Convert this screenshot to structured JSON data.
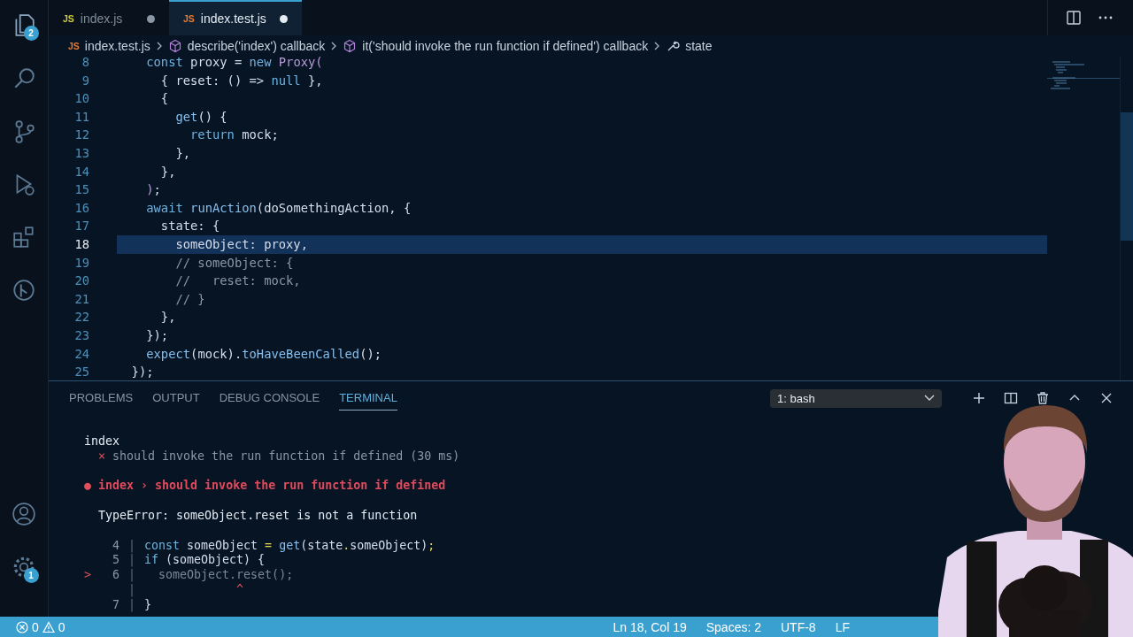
{
  "activity_bar": {
    "items": [
      {
        "kind": "files",
        "selected": true,
        "badge": "2"
      },
      {
        "kind": "search",
        "selected": false
      },
      {
        "kind": "source-control",
        "selected": false
      },
      {
        "kind": "debug",
        "selected": false
      },
      {
        "kind": "extensions",
        "selected": false
      },
      {
        "kind": "remote",
        "selected": false
      }
    ],
    "bottom": [
      {
        "kind": "account"
      },
      {
        "kind": "settings",
        "badge": "1"
      }
    ]
  },
  "tabs": [
    {
      "icon_text": "JS",
      "color": "#cbcb41",
      "label": "index.js",
      "selected": false,
      "dirty": true
    },
    {
      "icon_text": "JS",
      "color": "#e37933",
      "label": "index.test.js",
      "selected": true,
      "dirty": true
    }
  ],
  "breadcrumbs": [
    {
      "kind": "file",
      "icon_text": "JS",
      "color": "#e37933",
      "label": "index.test.js"
    },
    {
      "kind": "symbol",
      "label": "describe('index') callback"
    },
    {
      "kind": "symbol",
      "label": "it('should invoke the run function if defined') callback"
    },
    {
      "kind": "property",
      "label": "state"
    }
  ],
  "editor": {
    "lines": [
      {
        "number": "8",
        "highlighted": false,
        "tokens": [
          {
            "kind": "keyword",
            "text": "    const "
          },
          {
            "kind": "plain",
            "text": "proxy = "
          },
          {
            "kind": "keyword",
            "text": "new "
          },
          {
            "kind": "type",
            "text": "Proxy("
          }
        ]
      },
      {
        "number": "9",
        "highlighted": false,
        "tokens": [
          {
            "kind": "plain",
            "text": "      { reset: () => "
          },
          {
            "kind": "keyword",
            "text": "null"
          },
          {
            "kind": "plain",
            "text": " },"
          }
        ]
      },
      {
        "number": "10",
        "highlighted": false,
        "tokens": [
          {
            "kind": "plain",
            "text": "      {"
          }
        ]
      },
      {
        "number": "11",
        "highlighted": false,
        "tokens": [
          {
            "kind": "function",
            "text": "        get"
          },
          {
            "kind": "plain",
            "text": "() {"
          }
        ]
      },
      {
        "number": "12",
        "highlighted": false,
        "tokens": [
          {
            "kind": "keyword",
            "text": "          return "
          },
          {
            "kind": "plain",
            "text": "mock;"
          }
        ]
      },
      {
        "number": "13",
        "highlighted": false,
        "tokens": [
          {
            "kind": "plain",
            "text": "        },"
          }
        ]
      },
      {
        "number": "14",
        "highlighted": false,
        "tokens": [
          {
            "kind": "plain",
            "text": "      },"
          }
        ]
      },
      {
        "number": "15",
        "highlighted": false,
        "tokens": [
          {
            "kind": "type",
            "text": "    )"
          },
          {
            "kind": "plain",
            "text": ";"
          }
        ]
      },
      {
        "number": "16",
        "highlighted": false,
        "tokens": [
          {
            "kind": "keyword",
            "text": "    await "
          },
          {
            "kind": "function",
            "text": "runAction"
          },
          {
            "kind": "plain",
            "text": "(doSomethingAction, {"
          }
        ]
      },
      {
        "number": "17",
        "highlighted": false,
        "tokens": [
          {
            "kind": "plain",
            "text": "      state: {"
          }
        ]
      },
      {
        "number": "18",
        "highlighted": true,
        "tokens": [
          {
            "kind": "plain",
            "text": "        someObject: proxy,"
          }
        ]
      },
      {
        "number": "19",
        "highlighted": false,
        "tokens": [
          {
            "kind": "comment",
            "text": "        // someObject: {"
          }
        ]
      },
      {
        "number": "20",
        "highlighted": false,
        "tokens": [
          {
            "kind": "comment",
            "text": "        //   reset: mock,"
          }
        ]
      },
      {
        "number": "21",
        "highlighted": false,
        "tokens": [
          {
            "kind": "comment",
            "text": "        // }"
          }
        ]
      },
      {
        "number": "22",
        "highlighted": false,
        "tokens": [
          {
            "kind": "plain",
            "text": "      },"
          }
        ]
      },
      {
        "number": "23",
        "highlighted": false,
        "tokens": [
          {
            "kind": "plain",
            "text": "    });"
          }
        ]
      },
      {
        "number": "24",
        "highlighted": false,
        "tokens": [
          {
            "kind": "function",
            "text": "    expect"
          },
          {
            "kind": "plain",
            "text": "(mock)."
          },
          {
            "kind": "function",
            "text": "toHaveBeenCalled"
          },
          {
            "kind": "plain",
            "text": "();"
          }
        ]
      },
      {
        "number": "25",
        "highlighted": false,
        "tokens": [
          {
            "kind": "plain",
            "text": "  });"
          }
        ]
      }
    ]
  },
  "panel": {
    "tabs": [
      {
        "label": "PROBLEMS",
        "selected": false
      },
      {
        "label": "OUTPUT",
        "selected": false
      },
      {
        "label": "DEBUG CONSOLE",
        "selected": false
      },
      {
        "label": "TERMINAL",
        "selected": true
      }
    ],
    "terminal_select": {
      "value": "1: bash"
    },
    "terminal": {
      "suite": "index",
      "failed_test": {
        "mark": "×",
        "name": "should invoke the run function if defined (30 ms)"
      },
      "failure": {
        "bullet": "●",
        "title": "index › should invoke the run function if defined"
      },
      "error": "TypeError: someObject.reset is not a function",
      "frame": [
        {
          "kind": "line",
          "gutter": "|",
          "number": "4",
          "dim": false,
          "tokens": [
            {
              "kind": "keyword",
              "text": "const "
            },
            {
              "kind": "plain",
              "text": "someObject "
            },
            {
              "kind": "operator",
              "text": "= "
            },
            {
              "kind": "function",
              "text": "get"
            },
            {
              "kind": "plain",
              "text": "(state"
            },
            {
              "kind": "operator",
              "text": "."
            },
            {
              "kind": "plain",
              "text": "someObject)"
            },
            {
              "kind": "operator",
              "text": ";"
            }
          ]
        },
        {
          "kind": "line",
          "gutter": "|",
          "number": "5",
          "dim": false,
          "tokens": [
            {
              "kind": "keyword",
              "text": "if "
            },
            {
              "kind": "plain",
              "text": "(someObject) {"
            }
          ]
        },
        {
          "kind": "line",
          "marker": ">",
          "gutter": "|",
          "number": "6",
          "dim": true,
          "tokens": [
            {
              "kind": "plain",
              "text": "  someObject"
            },
            {
              "kind": "operator",
              "text": "."
            },
            {
              "kind": "plain",
              "text": "reset()"
            },
            {
              "kind": "operator",
              "text": ";"
            }
          ]
        },
        {
          "kind": "caret",
          "gutter": "|",
          "text": "             ^"
        },
        {
          "kind": "line",
          "gutter": "|",
          "number": "7",
          "dim": false,
          "tokens": [
            {
              "kind": "plain",
              "text": "}"
            }
          ]
        }
      ]
    }
  },
  "status_bar": {
    "errors": "0",
    "warnings": "0",
    "items": [
      "Ln 18, Col 19",
      "Spaces: 2",
      "UTF-8",
      "LF"
    ]
  }
}
